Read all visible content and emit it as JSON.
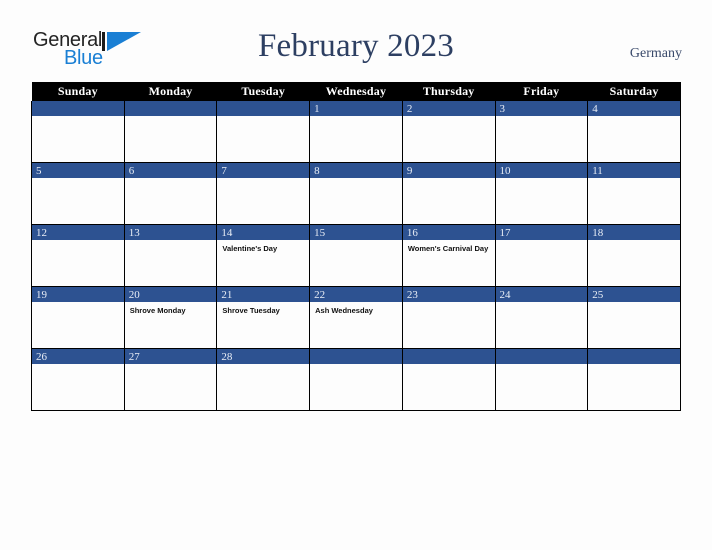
{
  "brand": {
    "logo_text_primary": "General",
    "logo_text_secondary": "Blue",
    "logo_mark_icon": "triangle-flag-icon",
    "primary_color": "#1a7fd4"
  },
  "header": {
    "title": "February 2023",
    "country": "Germany",
    "title_color": "#2d3f62"
  },
  "calendar": {
    "month": "February",
    "year": "2023",
    "header_bg": "#000000",
    "daynum_bg": "#2d5291",
    "weekday_headers": [
      "Sunday",
      "Monday",
      "Tuesday",
      "Wednesday",
      "Thursday",
      "Friday",
      "Saturday"
    ],
    "weeks": [
      [
        {
          "day": "",
          "event": ""
        },
        {
          "day": "",
          "event": ""
        },
        {
          "day": "",
          "event": ""
        },
        {
          "day": "1",
          "event": ""
        },
        {
          "day": "2",
          "event": ""
        },
        {
          "day": "3",
          "event": ""
        },
        {
          "day": "4",
          "event": ""
        }
      ],
      [
        {
          "day": "5",
          "event": ""
        },
        {
          "day": "6",
          "event": ""
        },
        {
          "day": "7",
          "event": ""
        },
        {
          "day": "8",
          "event": ""
        },
        {
          "day": "9",
          "event": ""
        },
        {
          "day": "10",
          "event": ""
        },
        {
          "day": "11",
          "event": ""
        }
      ],
      [
        {
          "day": "12",
          "event": ""
        },
        {
          "day": "13",
          "event": ""
        },
        {
          "day": "14",
          "event": "Valentine's Day"
        },
        {
          "day": "15",
          "event": ""
        },
        {
          "day": "16",
          "event": "Women's Carnival Day"
        },
        {
          "day": "17",
          "event": ""
        },
        {
          "day": "18",
          "event": ""
        }
      ],
      [
        {
          "day": "19",
          "event": ""
        },
        {
          "day": "20",
          "event": "Shrove Monday"
        },
        {
          "day": "21",
          "event": "Shrove Tuesday"
        },
        {
          "day": "22",
          "event": "Ash Wednesday"
        },
        {
          "day": "23",
          "event": ""
        },
        {
          "day": "24",
          "event": ""
        },
        {
          "day": "25",
          "event": ""
        }
      ],
      [
        {
          "day": "26",
          "event": ""
        },
        {
          "day": "27",
          "event": ""
        },
        {
          "day": "28",
          "event": ""
        },
        {
          "day": "",
          "event": ""
        },
        {
          "day": "",
          "event": ""
        },
        {
          "day": "",
          "event": ""
        },
        {
          "day": "",
          "event": ""
        }
      ]
    ]
  }
}
